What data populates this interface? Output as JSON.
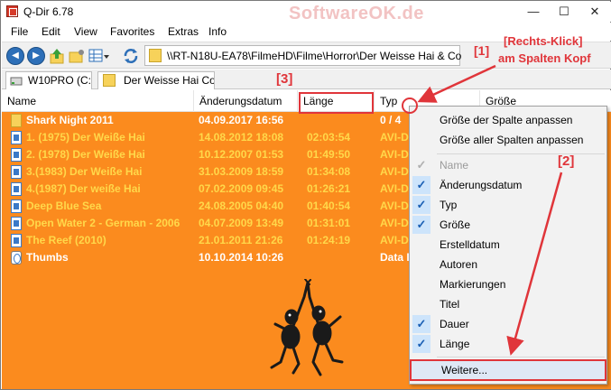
{
  "window": {
    "title": "Q-Dir 6.78",
    "watermark": "SoftwareOK.de",
    "minimize": "—",
    "maximize": "☐",
    "close": "✕"
  },
  "menu": [
    "File",
    "Edit",
    "View",
    "Favorites",
    "Extras",
    "Info"
  ],
  "address": {
    "path": "\\\\RT-N18U-EA78\\FilmeHD\\Filme\\Horror\\Der Weisse Hai & Co"
  },
  "tabs": [
    {
      "label": "W10PRO (C:)"
    },
    {
      "label": "Der Weisse Hai  Co"
    }
  ],
  "columns": {
    "name": "Name",
    "date": "Änderungsdatum",
    "length": "Länge",
    "type": "Typ",
    "size": "Größe"
  },
  "files": [
    {
      "name": "Shark Night 2011",
      "date": "04.09.2017 16:56",
      "length": "",
      "type": "0 / 4",
      "icon": "folder-icon"
    },
    {
      "name": "1. (1975) Der Weiße Hai",
      "date": "14.08.2012 18:08",
      "length": "02:03:54",
      "type": "AVI-D",
      "icon": "video-file-icon"
    },
    {
      "name": "2. (1978) Der Weiße Hai",
      "date": "10.12.2007 01:53",
      "length": "01:49:50",
      "type": "AVI-D",
      "icon": "video-file-icon"
    },
    {
      "name": "3.(1983) Der Weiße Hai",
      "date": "31.03.2009 18:59",
      "length": "01:34:08",
      "type": "AVI-D",
      "icon": "video-file-icon"
    },
    {
      "name": "4.(1987) Der weiße Hai",
      "date": "07.02.2009 09:45",
      "length": "01:26:21",
      "type": "AVI-D",
      "icon": "video-file-icon"
    },
    {
      "name": "Deep Blue Sea",
      "date": "24.08.2005 04:40",
      "length": "01:40:54",
      "type": "AVI-D",
      "icon": "video-file-icon"
    },
    {
      "name": "Open Water 2 - German - 2006",
      "date": "04.07.2009 13:49",
      "length": "01:31:01",
      "type": "AVI-D",
      "icon": "video-file-icon"
    },
    {
      "name": "The Reef (2010)",
      "date": "21.01.2011 21:26",
      "length": "01:24:19",
      "type": "AVI-D",
      "icon": "video-file-icon"
    },
    {
      "name": "Thumbs",
      "date": "10.10.2014 10:26",
      "length": "",
      "type": "Data I",
      "icon": "thumbs-file-icon"
    }
  ],
  "context_menu": {
    "fit_column": "Größe der Spalte anpassen",
    "fit_all_columns": "Größe aller Spalten anpassen",
    "items": [
      {
        "label": "Name",
        "checked": true,
        "disabled": true
      },
      {
        "label": "Änderungsdatum",
        "checked": true,
        "disabled": false
      },
      {
        "label": "Typ",
        "checked": true,
        "disabled": false
      },
      {
        "label": "Größe",
        "checked": true,
        "disabled": false
      },
      {
        "label": "Erstelldatum",
        "checked": false,
        "disabled": false
      },
      {
        "label": "Autoren",
        "checked": false,
        "disabled": false
      },
      {
        "label": "Markierungen",
        "checked": false,
        "disabled": false
      },
      {
        "label": "Titel",
        "checked": false,
        "disabled": false
      },
      {
        "label": "Dauer",
        "checked": true,
        "disabled": false
      },
      {
        "label": "Länge",
        "checked": true,
        "disabled": false
      }
    ],
    "more": "Weitere..."
  },
  "annotations": {
    "label1_num": "[1]",
    "label1_text_a": "[Rechts-Klick]",
    "label1_text_b": "am Spalten Kopf",
    "label2": "[2]",
    "label3": "[3]"
  },
  "colors": {
    "list_background": "#fb8b1e",
    "list_text": "#ffd84a",
    "annotation_red": "#e0353a",
    "check_blue": "#1a5fb4"
  }
}
